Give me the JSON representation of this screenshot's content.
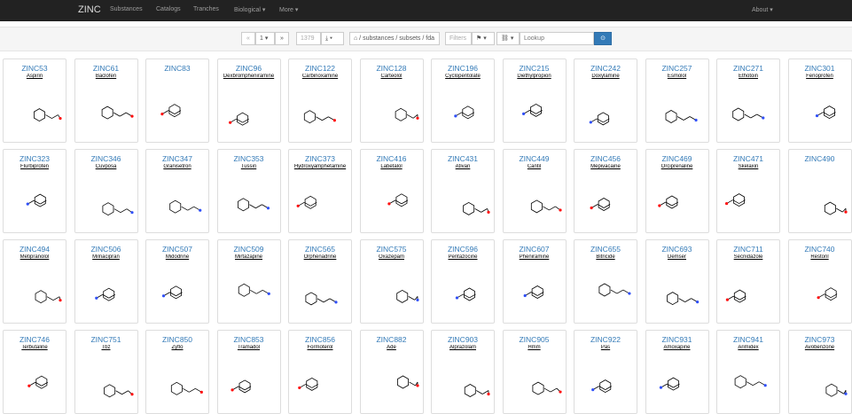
{
  "navbar": {
    "brand": "ZINC",
    "items": [
      {
        "label": "Substances"
      },
      {
        "label": "Catalogs"
      },
      {
        "label": "Tranches"
      },
      {
        "label": "Biological ▾"
      },
      {
        "label": "More ▾"
      }
    ],
    "about": "About ▾"
  },
  "toolbar": {
    "prev": "«",
    "page": "1 ▾",
    "next": "»",
    "count": "1379",
    "download": "⤓ ▾",
    "path": "⌂ / substances / subsets / fda",
    "filters": "Filters",
    "tag": "⚑ ▾",
    "link": "⛓ ▾",
    "lookup_placeholder": "Lookup",
    "go": "⊙"
  },
  "cards": [
    {
      "id": "ZINC53",
      "name": "Aspirin"
    },
    {
      "id": "ZINC61",
      "name": "Baclofen"
    },
    {
      "id": "ZINC83",
      "name": ""
    },
    {
      "id": "ZINC96",
      "name": "Dexbrompheniramine"
    },
    {
      "id": "ZINC122",
      "name": "Carbinoxamine"
    },
    {
      "id": "ZINC128",
      "name": "Carteolol"
    },
    {
      "id": "ZINC196",
      "name": "Cyclopentolate"
    },
    {
      "id": "ZINC215",
      "name": "Diethylpropion"
    },
    {
      "id": "ZINC242",
      "name": "Doxylamine"
    },
    {
      "id": "ZINC257",
      "name": "Esmolol"
    },
    {
      "id": "ZINC271",
      "name": "Ethotoin"
    },
    {
      "id": "ZINC301",
      "name": "Fenoprofen"
    },
    {
      "id": "ZINC323",
      "name": "Flurbiprofen"
    },
    {
      "id": "ZINC346",
      "name": "Cuvposa"
    },
    {
      "id": "ZINC347",
      "name": "Granisetron"
    },
    {
      "id": "ZINC353",
      "name": "Tussin"
    },
    {
      "id": "ZINC373",
      "name": "Hydroxyamphetamine"
    },
    {
      "id": "ZINC416",
      "name": "Labetalol"
    },
    {
      "id": "ZINC431",
      "name": "Ativan"
    },
    {
      "id": "ZINC449",
      "name": "Cantil"
    },
    {
      "id": "ZINC456",
      "name": "Mepivacaine"
    },
    {
      "id": "ZINC469",
      "name": "Orciprenaline"
    },
    {
      "id": "ZINC471",
      "name": "Skelaxin"
    },
    {
      "id": "ZINC490",
      "name": ""
    },
    {
      "id": "ZINC494",
      "name": "Metipranolol"
    },
    {
      "id": "ZINC506",
      "name": "Milnacipran"
    },
    {
      "id": "ZINC507",
      "name": "Midodrine"
    },
    {
      "id": "ZINC509",
      "name": "Mirtazapine"
    },
    {
      "id": "ZINC565",
      "name": "Orphenadrine"
    },
    {
      "id": "ZINC575",
      "name": "Oxazepam"
    },
    {
      "id": "ZINC596",
      "name": "Pentazocine"
    },
    {
      "id": "ZINC607",
      "name": "Pheniramine"
    },
    {
      "id": "ZINC655",
      "name": "Bitricide"
    },
    {
      "id": "ZINC693",
      "name": "Demser"
    },
    {
      "id": "ZINC711",
      "name": "Secnidazole"
    },
    {
      "id": "ZINC740",
      "name": "Restoril"
    },
    {
      "id": "ZINC746",
      "name": "Terbutaline"
    },
    {
      "id": "ZINC751",
      "name": "Tbz"
    },
    {
      "id": "ZINC850",
      "name": "Zyflo"
    },
    {
      "id": "ZINC853",
      "name": "Tramadol"
    },
    {
      "id": "ZINC856",
      "name": "Formoterol"
    },
    {
      "id": "ZINC882",
      "name": "Ade"
    },
    {
      "id": "ZINC903",
      "name": "Alprazolam"
    },
    {
      "id": "ZINC905",
      "name": "Hmm"
    },
    {
      "id": "ZINC922",
      "name": "Pas"
    },
    {
      "id": "ZINC931",
      "name": "Amoxapine"
    },
    {
      "id": "ZINC941",
      "name": "Arimidex"
    },
    {
      "id": "ZINC973",
      "name": "Avobenzone"
    }
  ],
  "colors": {
    "navbar": "#222222",
    "link": "#337ab7",
    "primary": "#337ab7",
    "bond": "#000000",
    "oxygen": "#ff0d0d",
    "nitrogen": "#3050f8",
    "chlorine": "#1ff01f"
  }
}
